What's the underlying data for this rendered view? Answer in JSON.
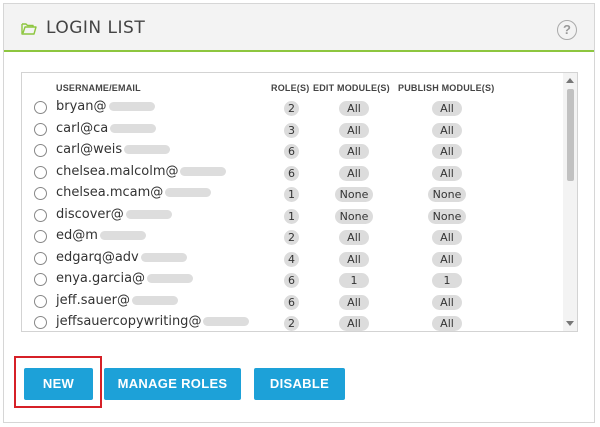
{
  "panel": {
    "title": "LOGIN LIST",
    "help_symbol": "?"
  },
  "columns": {
    "username": "USERNAME/EMAIL",
    "roles": "ROLE(S)",
    "edit": "EDIT MODULE(S)",
    "publish": "PUBLISH MODULE(S)"
  },
  "rows": [
    {
      "email": "bryan@",
      "roles": "2",
      "edit": "All",
      "publish": "All"
    },
    {
      "email": "carl@ca",
      "roles": "3",
      "edit": "All",
      "publish": "All"
    },
    {
      "email": "carl@weis",
      "roles": "6",
      "edit": "All",
      "publish": "All"
    },
    {
      "email": "chelsea.malcolm@",
      "roles": "6",
      "edit": "All",
      "publish": "All"
    },
    {
      "email": "chelsea.mcam@",
      "roles": "1",
      "edit": "None",
      "publish": "None"
    },
    {
      "email": "discover@",
      "roles": "1",
      "edit": "None",
      "publish": "None"
    },
    {
      "email": "ed@m",
      "roles": "2",
      "edit": "All",
      "publish": "All"
    },
    {
      "email": "edgarq@adv",
      "roles": "4",
      "edit": "All",
      "publish": "All"
    },
    {
      "email": "enya.garcia@",
      "roles": "6",
      "edit": "1",
      "publish": "1"
    },
    {
      "email": "jeff.sauer@",
      "roles": "6",
      "edit": "All",
      "publish": "All"
    },
    {
      "email": "jeffsauercopywriting@",
      "roles": "2",
      "edit": "All",
      "publish": "All"
    }
  ],
  "buttons": {
    "new": "NEW",
    "manage_roles": "MANAGE ROLES",
    "disable": "DISABLE"
  },
  "colors": {
    "accent": "#1da1d8",
    "header_border": "#8dc63f",
    "highlight": "#d62027"
  },
  "icons": {
    "folder": "folder-open-icon",
    "help": "help-icon"
  }
}
